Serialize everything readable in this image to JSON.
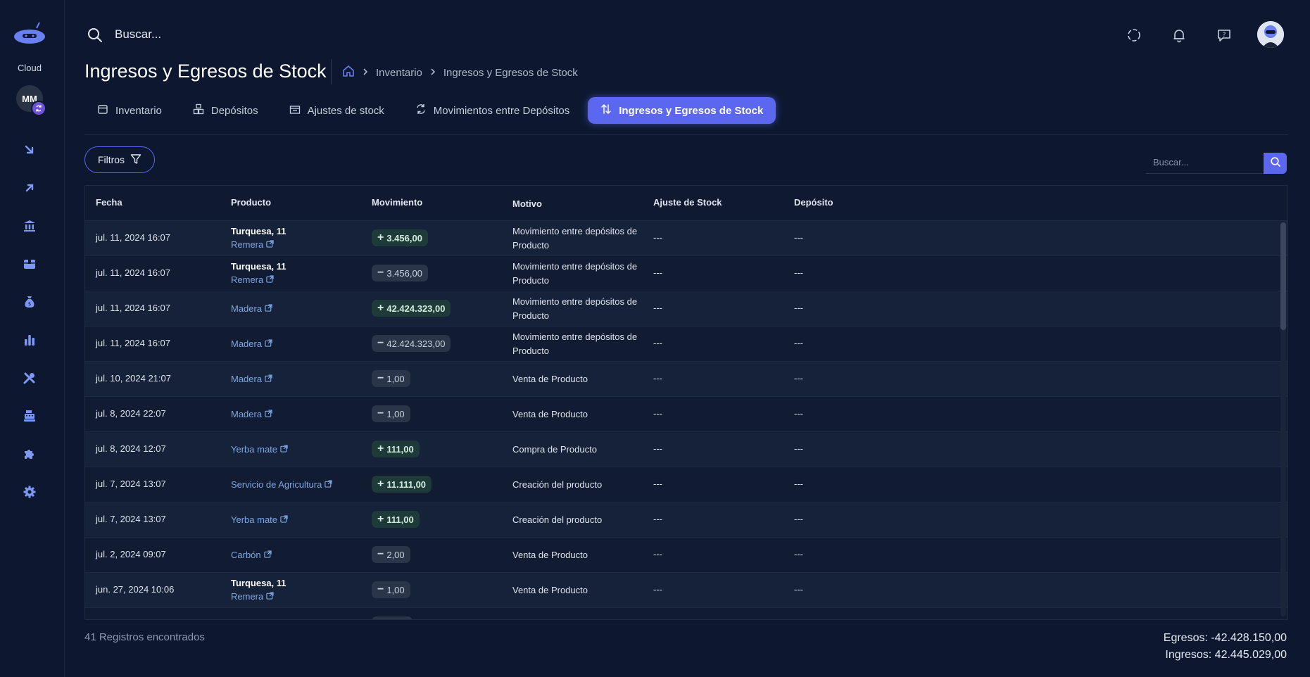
{
  "sidebar": {
    "cloud_label": "Cloud",
    "avatar_initials": "MM",
    "items": [
      {
        "icon": "arrow-down-right-icon"
      },
      {
        "icon": "arrow-up-right-icon"
      },
      {
        "icon": "bank-icon"
      },
      {
        "icon": "box-icon"
      },
      {
        "icon": "money-bag-icon"
      },
      {
        "icon": "bar-chart-icon"
      },
      {
        "icon": "tools-icon"
      },
      {
        "icon": "cash-register-icon"
      },
      {
        "icon": "puzzle-icon"
      },
      {
        "icon": "gear-icon"
      }
    ]
  },
  "topbar": {
    "search_placeholder": "Buscar..."
  },
  "page": {
    "title": "Ingresos y Egresos de Stock",
    "breadcrumb": [
      "Inventario",
      "Ingresos y Egresos de Stock"
    ]
  },
  "tabs": [
    {
      "label": "Inventario",
      "icon": "calendar-icon"
    },
    {
      "label": "Depósitos",
      "icon": "boxes-icon"
    },
    {
      "label": "Ajustes de stock",
      "icon": "adjust-box-icon"
    },
    {
      "label": "Movimientos entre Depósitos",
      "icon": "transfer-icon"
    },
    {
      "label": "Ingresos y Egresos de Stock",
      "icon": "up-down-arrows-icon",
      "active": true
    }
  ],
  "filters": {
    "label": "Filtros",
    "search_placeholder": "Buscar..."
  },
  "table": {
    "headers": [
      "Fecha",
      "Producto",
      "Movimiento",
      "Motivo",
      "Ajuste de Stock",
      "Depósito"
    ],
    "rows": [
      {
        "fecha": "jul. 11, 2024 16:07",
        "variant": "Turquesa, 11",
        "product": "Remera",
        "sign": "+",
        "amount": "3.456,00",
        "motivo": "Movimiento entre depósitos de Producto",
        "ajuste": "---",
        "deposito": "---"
      },
      {
        "fecha": "jul. 11, 2024 16:07",
        "variant": "Turquesa, 11",
        "product": "Remera",
        "sign": "−",
        "amount": "3.456,00",
        "motivo": "Movimiento entre depósitos de Producto",
        "ajuste": "---",
        "deposito": "---"
      },
      {
        "fecha": "jul. 11, 2024 16:07",
        "variant": "",
        "product": "Madera",
        "sign": "+",
        "amount": "42.424.323,00",
        "motivo": "Movimiento entre depósitos de Producto",
        "ajuste": "---",
        "deposito": "---"
      },
      {
        "fecha": "jul. 11, 2024 16:07",
        "variant": "",
        "product": "Madera",
        "sign": "−",
        "amount": "42.424.323,00",
        "motivo": "Movimiento entre depósitos de Producto",
        "ajuste": "---",
        "deposito": "---"
      },
      {
        "fecha": "jul. 10, 2024 21:07",
        "variant": "",
        "product": "Madera",
        "sign": "−",
        "amount": "1,00",
        "motivo": "Venta de Producto",
        "ajuste": "---",
        "deposito": "---"
      },
      {
        "fecha": "jul. 8, 2024 22:07",
        "variant": "",
        "product": "Madera",
        "sign": "−",
        "amount": "1,00",
        "motivo": "Venta de Producto",
        "ajuste": "---",
        "deposito": "---"
      },
      {
        "fecha": "jul. 8, 2024 12:07",
        "variant": "",
        "product": "Yerba mate",
        "sign": "+",
        "amount": "111,00",
        "motivo": "Compra de Producto",
        "ajuste": "---",
        "deposito": "---"
      },
      {
        "fecha": "jul. 7, 2024 13:07",
        "variant": "",
        "product": "Servicio de Agricultura",
        "sign": "+",
        "amount": "11.111,00",
        "motivo": "Creación del producto",
        "ajuste": "---",
        "deposito": "---"
      },
      {
        "fecha": "jul. 7, 2024 13:07",
        "variant": "",
        "product": "Yerba mate",
        "sign": "+",
        "amount": "111,00",
        "motivo": "Creación del producto",
        "ajuste": "---",
        "deposito": "---"
      },
      {
        "fecha": "jul. 2, 2024 09:07",
        "variant": "",
        "product": "Carbón",
        "sign": "−",
        "amount": "2,00",
        "motivo": "Venta de Producto",
        "ajuste": "---",
        "deposito": "---"
      },
      {
        "fecha": "jun. 27, 2024 10:06",
        "variant": "Turquesa, 11",
        "product": "Remera",
        "sign": "−",
        "amount": "1,00",
        "motivo": "Venta de Producto",
        "ajuste": "---",
        "deposito": "---"
      }
    ]
  },
  "footer": {
    "records": "41 Registros encontrados",
    "egresos": "Egresos: -42.428.150,00",
    "ingresos": "Ingresos: 42.445.029,00"
  },
  "colors": {
    "accent": "#5b67ee",
    "background": "#0d1830",
    "positive_badge": "#1f3b39",
    "negative_badge": "#2a3549",
    "link": "#7ea6e0"
  }
}
